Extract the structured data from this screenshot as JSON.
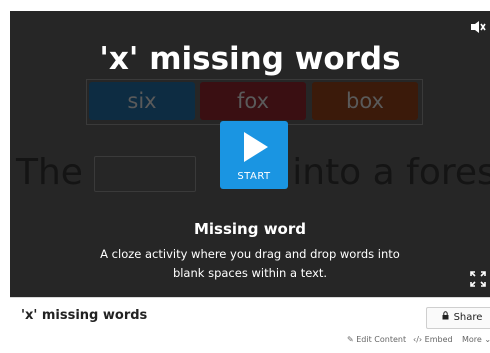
{
  "player": {
    "title": "'x' missing words",
    "word_cards": [
      "six",
      "fox",
      "box"
    ],
    "sentence_start": "The",
    "sentence_end": "r into a forest.",
    "start_label": "START",
    "description_title": "Missing word",
    "description_text": "A cloze activity where you drag and drop words into blank spaces within a text.",
    "play_color": "#1a95e2"
  },
  "footer": {
    "title": "'x' missing words",
    "share_label": "Share",
    "edit_label": "✎ Edit Content",
    "embed_label": "‹/› Embed",
    "more_label": "More ⌄"
  }
}
